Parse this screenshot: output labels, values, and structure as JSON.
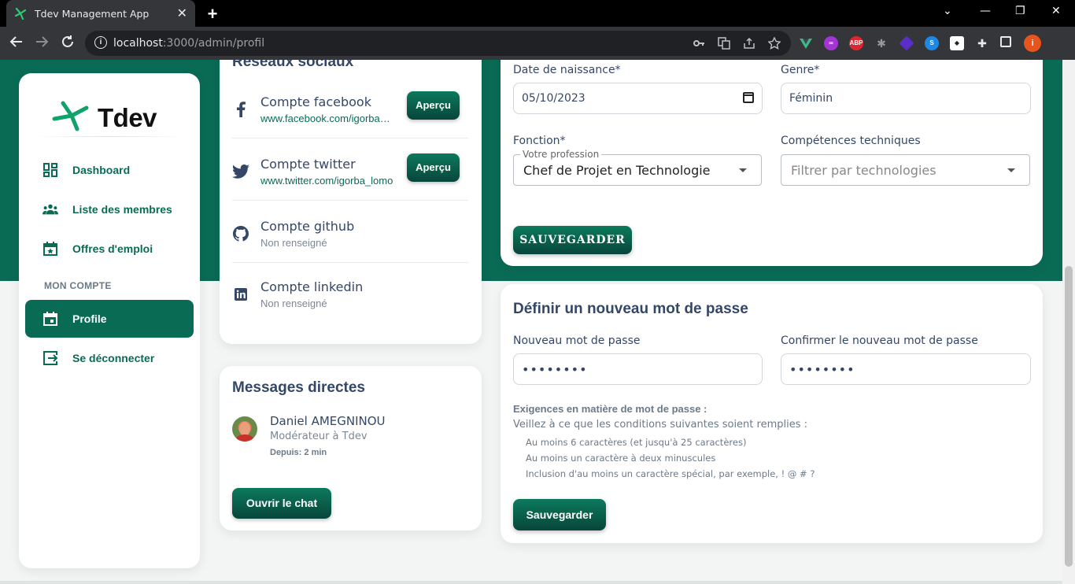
{
  "browser": {
    "tab_title": "Tdev Management App",
    "tab_close": "✕",
    "new_tab": "+",
    "url_host": "localhost",
    "url_rest": ":3000/admin/profil",
    "window_controls": {
      "minimize": "—",
      "restore": "❐",
      "close": "✕",
      "dropdown": "⌄"
    },
    "extensions": [
      "vue-devtools-icon",
      "extension-purple-icon",
      "adblock-plus-icon",
      "spider-icon",
      "extension-violet-icon",
      "shazam-icon",
      "extension-box-icon",
      "puzzle-icon",
      "side-panel-icon",
      "profile-avatar-icon"
    ],
    "abp_label": "ABP",
    "profile_initial": "i"
  },
  "sidebar": {
    "brand": "Tdev",
    "items": [
      {
        "label": "Dashboard",
        "icon": "dashboard-icon"
      },
      {
        "label": "Liste des membres",
        "icon": "people-icon"
      },
      {
        "label": "Offres d'emploi",
        "icon": "calendar-star-icon"
      }
    ],
    "section_label": "MON COMPTE",
    "account_items": [
      {
        "label": "Profile",
        "icon": "calendar-icon",
        "active": true
      },
      {
        "label": "Se déconnecter",
        "icon": "logout-icon"
      }
    ]
  },
  "social": {
    "title": "Réseaux sociaux",
    "rows": [
      {
        "name": "Compte facebook",
        "link": "www.facebook.com/igorbadjibo",
        "icon": "facebook-icon",
        "button": "Aperçu"
      },
      {
        "name": "Compte twitter",
        "link": "www.twitter.com/igorba_lomo",
        "icon": "twitter-icon",
        "button": "Aperçu"
      },
      {
        "name": "Compte github",
        "link": "Non renseigné",
        "icon": "github-icon"
      },
      {
        "name": "Compte linkedin",
        "link": "Non renseigné",
        "icon": "linkedin-icon"
      }
    ]
  },
  "messages": {
    "title": "Messages directes",
    "name": "Daniel AMEGNINOU",
    "role": "Modérateur à Tdev",
    "time": "Depuis: 2 min",
    "button": "Ouvrir le chat"
  },
  "profile_form": {
    "birth_label": "Date de naissance*",
    "birth_value": "05/10/2023",
    "gender_label": "Genre*",
    "gender_value": "Féminin",
    "function_label": "Fonction*",
    "function_legend": "Votre profession",
    "function_value": "Chef de Projet en Technologie",
    "skills_label": "Compétences techniques",
    "skills_placeholder": "Filtrer par technologies",
    "save": "SAUVEGARDER"
  },
  "password": {
    "title": "Définir un nouveau mot de passe",
    "new_label": "Nouveau mot de passe",
    "new_value": "••••••••",
    "confirm_label": "Confirmer le nouveau mot de passe",
    "confirm_value": "••••••••",
    "req_title": "Exigences en matière de mot de passe :",
    "req_sub": "Veillez à ce que les conditions suivantes soient remplies :",
    "requirements": [
      "Au moins 6 caractères (et jusqu'à 25 caractères)",
      "Au moins un caractère à deux minuscules",
      "Inclusion d'au moins un caractère spécial, par exemple, ! @ # ?"
    ],
    "save": "Sauvegarder"
  },
  "colors": {
    "brand": "#0a6b55",
    "brand_dark": "#08463b",
    "text": "#344767"
  }
}
